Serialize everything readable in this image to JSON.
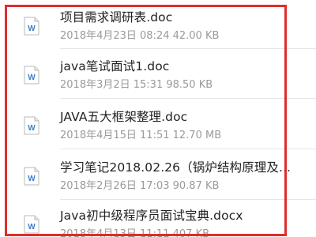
{
  "file_list": {
    "items": [
      {
        "name": "项目需求调研表.doc",
        "meta": "2018年4月23日 08:24 42.00 KB",
        "icon": "word-doc-icon"
      },
      {
        "name": "java笔试面试1.doc",
        "meta": "2018年3月2日 15:31 98.50 KB",
        "icon": "word-doc-icon"
      },
      {
        "name": "JAVA五大框架整理.doc",
        "meta": "2018年4月15日 11:51 12.70 MB",
        "icon": "word-doc-icon"
      },
      {
        "name": "学习笔记2018.02.26（锅炉结构原理及...",
        "meta": "2018年2月26日 17:03 90.87 KB",
        "icon": "word-doc-icon"
      },
      {
        "name": "Java初中级程序员面试宝典.docx",
        "meta": "2018年4月13日 11:11 407 KB",
        "icon": "word-doc-icon"
      }
    ]
  },
  "colors": {
    "highlight": "#e12b2b",
    "icon_letter": "#3f7fc9",
    "name_text": "#222222",
    "meta_text": "#9a9a9a"
  }
}
